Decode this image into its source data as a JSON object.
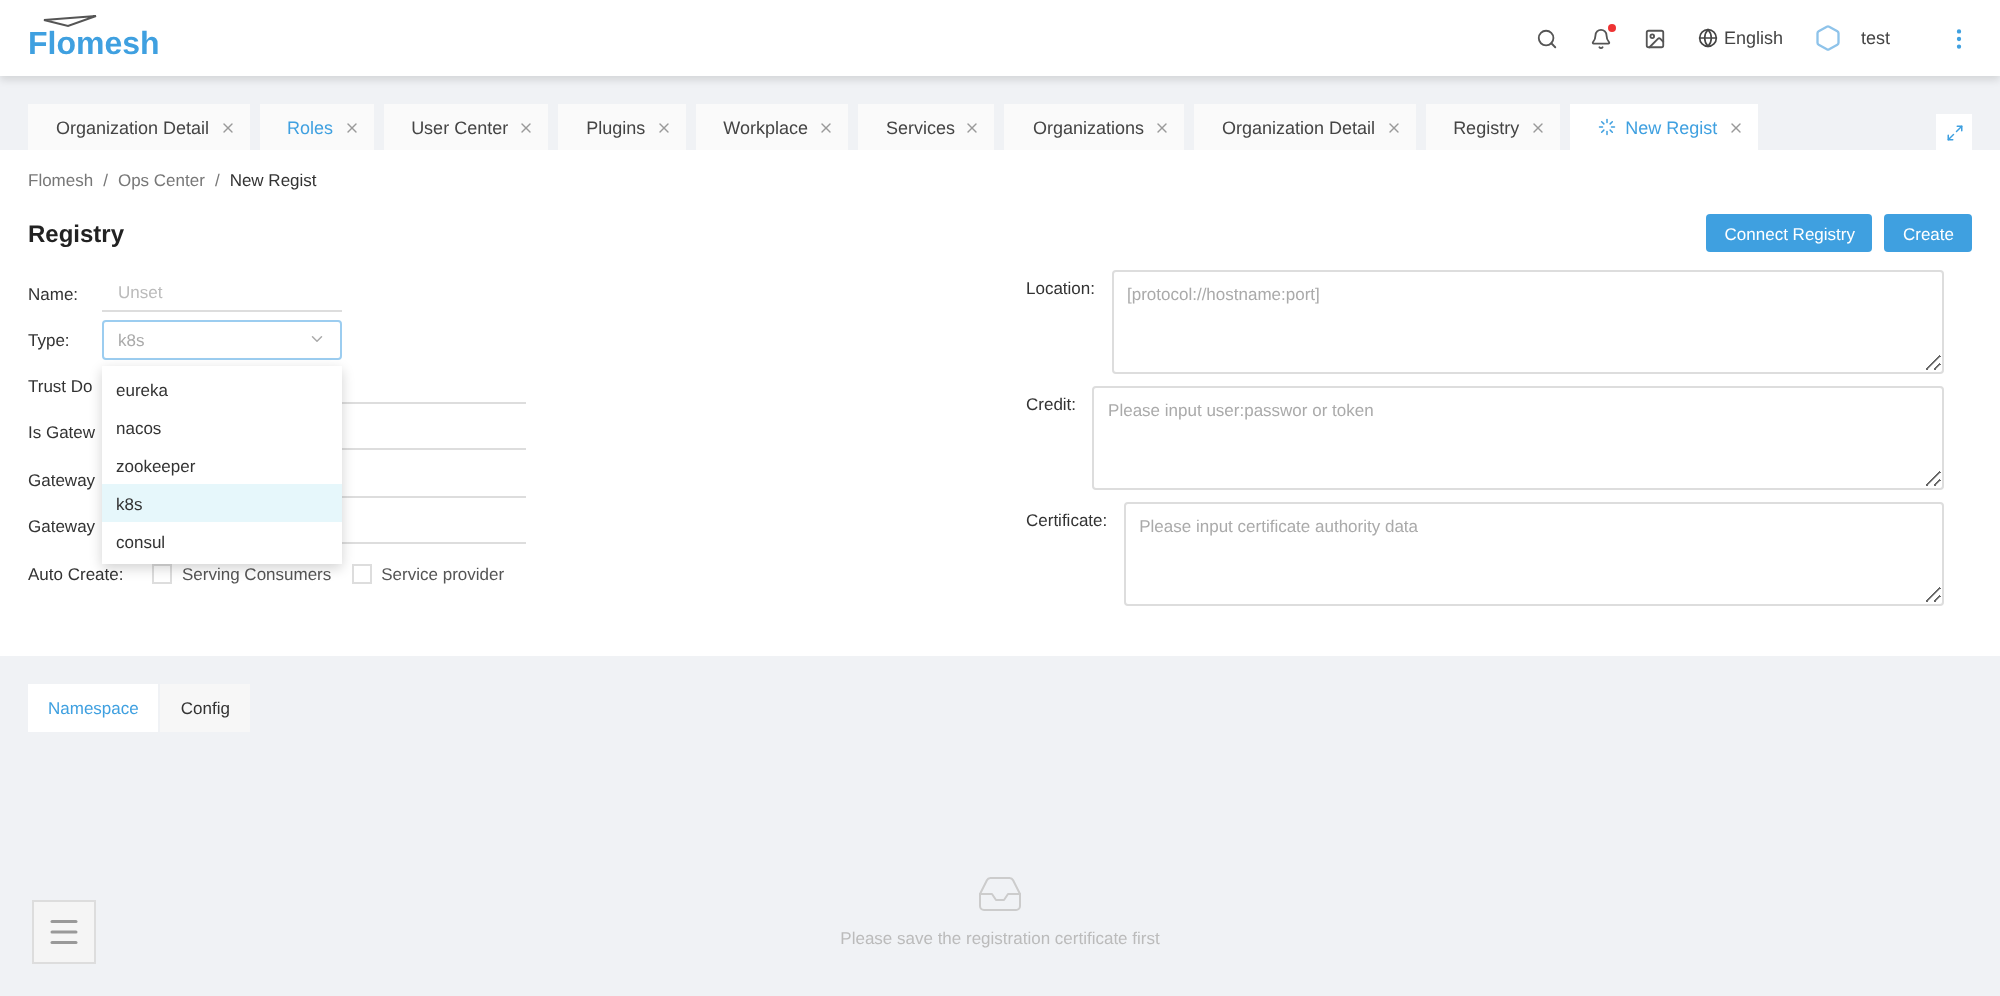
{
  "header": {
    "logo": "Flomesh",
    "language": "English",
    "user": "test",
    "has_notification": true
  },
  "tabs": [
    {
      "label": "Organization Detail",
      "selected": false,
      "highlighted": false,
      "loading": false
    },
    {
      "label": "Roles",
      "selected": false,
      "highlighted": true,
      "loading": false
    },
    {
      "label": "User Center",
      "selected": false,
      "highlighted": false,
      "loading": false
    },
    {
      "label": "Plugins",
      "selected": false,
      "highlighted": false,
      "loading": false
    },
    {
      "label": "Workplace",
      "selected": false,
      "highlighted": false,
      "loading": false
    },
    {
      "label": "Services",
      "selected": false,
      "highlighted": false,
      "loading": false
    },
    {
      "label": "Organizations",
      "selected": false,
      "highlighted": false,
      "loading": false
    },
    {
      "label": "Organization Detail",
      "selected": false,
      "highlighted": false,
      "loading": false
    },
    {
      "label": "Registry",
      "selected": false,
      "highlighted": false,
      "loading": false
    },
    {
      "label": "New Regist",
      "selected": true,
      "highlighted": true,
      "loading": true
    }
  ],
  "breadcrumb": [
    "Flomesh",
    "Ops Center",
    "New Regist"
  ],
  "breadcrumb_separator": "/",
  "page_title": "Registry",
  "buttons": [
    "Connect Registry",
    "Create"
  ],
  "form_left": {
    "name": {
      "label": "Name:",
      "placeholder": "Unset"
    },
    "type": {
      "label": "Type:",
      "value": "k8s",
      "expanded": true,
      "options": [
        {
          "label": "eureka",
          "selected": false
        },
        {
          "label": "nacos",
          "selected": false
        },
        {
          "label": "zookeeper",
          "selected": false
        },
        {
          "label": "k8s",
          "selected": true
        },
        {
          "label": "consul",
          "selected": false
        }
      ]
    },
    "hidden_rows": [
      "Trust Do",
      "Is Gatew",
      "Gateway",
      "Gateway"
    ],
    "auto_create": {
      "label": "Auto Create:",
      "options": [
        {
          "label": "Serving Consumers",
          "checked": false
        },
        {
          "label": "Service provider",
          "checked": false
        }
      ]
    }
  },
  "form_right": [
    {
      "label": "Location:",
      "placeholder": "[protocol://hostname:port]"
    },
    {
      "label": "Credit:",
      "placeholder": "Please input user:passwor or token"
    },
    {
      "label": "Certificate:",
      "placeholder": "Please input certificate authority data"
    }
  ],
  "bottom_tabs": [
    {
      "label": "Namespace",
      "selected": true
    },
    {
      "label": "Config",
      "selected": false
    }
  ],
  "empty_message": "Please save the registration certificate first"
}
